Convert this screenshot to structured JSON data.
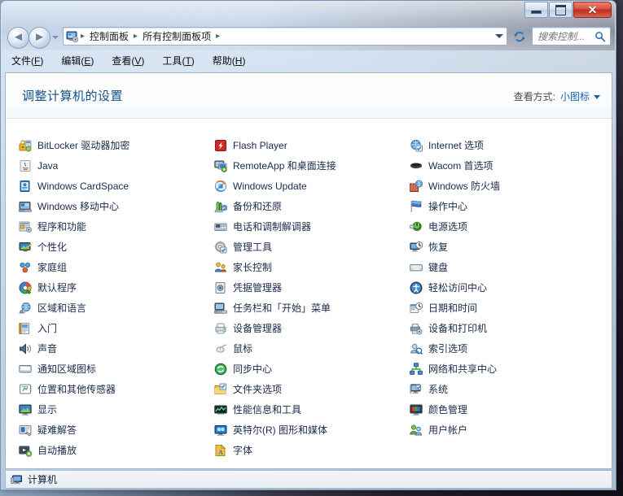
{
  "window": {
    "title": "",
    "controls": {
      "minimize": "最小化",
      "maximize": "最大化",
      "close": "✕"
    }
  },
  "nav": {
    "back_label": "后退",
    "forward_label": "前进",
    "back_glyph": "◄",
    "forward_glyph": "►",
    "history_dropdown_label": "最近访问的位置",
    "refresh_label": "刷新",
    "address_icon": "control-panel-icon",
    "breadcrumbs": [
      {
        "label": "控制面板"
      },
      {
        "label": "所有控制面板项"
      }
    ],
    "separator": "▸",
    "address_dropdown_label": "以前的位置"
  },
  "search": {
    "placeholder": "搜索控制...",
    "value": "",
    "icon": "search-icon"
  },
  "menu": {
    "items": [
      {
        "label": "文件",
        "accel": "F"
      },
      {
        "label": "编辑",
        "accel": "E"
      },
      {
        "label": "查看",
        "accel": "V"
      },
      {
        "label": "工具",
        "accel": "T"
      },
      {
        "label": "帮助",
        "accel": "H"
      }
    ]
  },
  "header": {
    "title": "调整计算机的设置",
    "view_by_label": "查看方式:",
    "view_by_value": "小图标"
  },
  "columns": [
    {
      "items": [
        {
          "label": "BitLocker 驱动器加密",
          "icon": "bitlocker-icon"
        },
        {
          "label": "Java",
          "icon": "java-icon"
        },
        {
          "label": "Windows CardSpace",
          "icon": "cardspace-icon"
        },
        {
          "label": "Windows 移动中心",
          "icon": "mobility-center-icon"
        },
        {
          "label": "程序和功能",
          "icon": "programs-features-icon"
        },
        {
          "label": "个性化",
          "icon": "personalization-icon"
        },
        {
          "label": "家庭组",
          "icon": "homegroup-icon"
        },
        {
          "label": "默认程序",
          "icon": "default-programs-icon"
        },
        {
          "label": "区域和语言",
          "icon": "region-language-icon"
        },
        {
          "label": "入门",
          "icon": "getting-started-icon"
        },
        {
          "label": "声音",
          "icon": "sound-icon"
        },
        {
          "label": "通知区域图标",
          "icon": "notification-area-icon"
        },
        {
          "label": "位置和其他传感器",
          "icon": "location-sensors-icon"
        },
        {
          "label": "显示",
          "icon": "display-icon"
        },
        {
          "label": "疑难解答",
          "icon": "troubleshooting-icon"
        },
        {
          "label": "自动播放",
          "icon": "autoplay-icon"
        }
      ]
    },
    {
      "items": [
        {
          "label": "Flash Player",
          "icon": "flash-player-icon"
        },
        {
          "label": "RemoteApp 和桌面连接",
          "icon": "remoteapp-icon"
        },
        {
          "label": "Windows Update",
          "icon": "windows-update-icon"
        },
        {
          "label": "备份和还原",
          "icon": "backup-restore-icon"
        },
        {
          "label": "电话和调制解调器",
          "icon": "phone-modem-icon"
        },
        {
          "label": "管理工具",
          "icon": "administrative-tools-icon"
        },
        {
          "label": "家长控制",
          "icon": "parental-controls-icon"
        },
        {
          "label": "凭据管理器",
          "icon": "credential-manager-icon"
        },
        {
          "label": "任务栏和「开始」菜单",
          "icon": "taskbar-startmenu-icon"
        },
        {
          "label": "设备管理器",
          "icon": "device-manager-icon"
        },
        {
          "label": "鼠标",
          "icon": "mouse-icon"
        },
        {
          "label": "同步中心",
          "icon": "sync-center-icon"
        },
        {
          "label": "文件夹选项",
          "icon": "folder-options-icon"
        },
        {
          "label": "性能信息和工具",
          "icon": "performance-tools-icon"
        },
        {
          "label": "英特尔(R) 图形和媒体",
          "icon": "intel-graphics-icon"
        },
        {
          "label": "字体",
          "icon": "fonts-icon"
        }
      ]
    },
    {
      "items": [
        {
          "label": "Internet 选项",
          "icon": "internet-options-icon"
        },
        {
          "label": "Wacom 首选项",
          "icon": "wacom-icon"
        },
        {
          "label": "Windows 防火墙",
          "icon": "firewall-icon"
        },
        {
          "label": "操作中心",
          "icon": "action-center-icon"
        },
        {
          "label": "电源选项",
          "icon": "power-options-icon"
        },
        {
          "label": "恢复",
          "icon": "recovery-icon"
        },
        {
          "label": "键盘",
          "icon": "keyboard-icon"
        },
        {
          "label": "轻松访问中心",
          "icon": "ease-of-access-icon"
        },
        {
          "label": "日期和时间",
          "icon": "date-time-icon"
        },
        {
          "label": "设备和打印机",
          "icon": "devices-printers-icon"
        },
        {
          "label": "索引选项",
          "icon": "indexing-options-icon"
        },
        {
          "label": "网络和共享中心",
          "icon": "network-sharing-icon"
        },
        {
          "label": "系统",
          "icon": "system-icon"
        },
        {
          "label": "颜色管理",
          "icon": "color-management-icon"
        },
        {
          "label": "用户帐户",
          "icon": "user-accounts-icon"
        }
      ]
    }
  ],
  "statusbar": {
    "label": "计算机",
    "icon": "computer-icon"
  },
  "colors": {
    "link": "#1763aa",
    "title": "#16518a",
    "item_text": "#1a2a4a",
    "close_button": "#bf2e1c",
    "frame": "#9eb4ca"
  }
}
